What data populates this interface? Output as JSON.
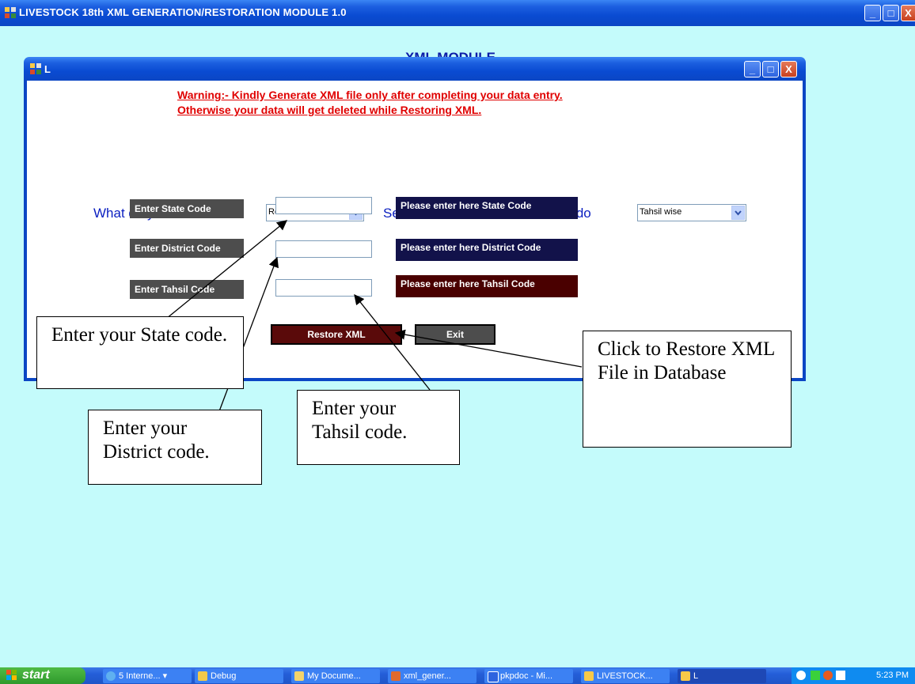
{
  "window": {
    "title": "LIVESTOCK 18th XML GENERATION/RESTORATION MODULE 1.0",
    "minimize_glyph": "_",
    "maximize_glyph": "□",
    "close_glyph": "X"
  },
  "background_title": "XML MODULE",
  "dialog": {
    "title": "L",
    "warning_line1": "Warning:- Kindly Generate XML file only after completing your data entry.",
    "warning_line2": "Otherwise your data will get deleted while Restoring XML.",
    "what_label": "What do you want to do",
    "what_value": "Restore XML",
    "level_label": "Select at what level You want to do",
    "level_value": "Tahsil wise",
    "state_label": "Enter State Code",
    "district_label": "Enter District Code",
    "tahsil_label": "Enter Tahsil Code",
    "state_value": "",
    "district_value": "",
    "tahsil_value": "",
    "state_hint": "Please enter here State Code",
    "district_hint": "Please enter here District Code",
    "tahsil_hint": "Please enter here Tahsil Code",
    "restore_button": "Restore XML",
    "exit_button": "Exit"
  },
  "annotations": {
    "state": "Enter your State code.",
    "district": "Enter your District code.",
    "tahsil": "Enter your Tahsil code.",
    "restore": "Click to Restore XML File in Database"
  },
  "taskbar": {
    "start_label": "start",
    "items": [
      "5 Interne...",
      "Debug",
      "My Docume...",
      "xml_gener...",
      "pkpdoc - Mi...",
      "LIVESTOCK...",
      "L"
    ],
    "clock": "5:23 PM"
  },
  "colors": {
    "desktop_bg": "#c4fbfb",
    "title_blue": "#0b46c4",
    "warning_red": "#e00000",
    "label_blue": "#0a1ec0",
    "hint_navy": "#12124a",
    "hint_maroon": "#4a0000",
    "restore_maroon": "#5a0a0a",
    "exit_gray": "#4d4d4d"
  }
}
